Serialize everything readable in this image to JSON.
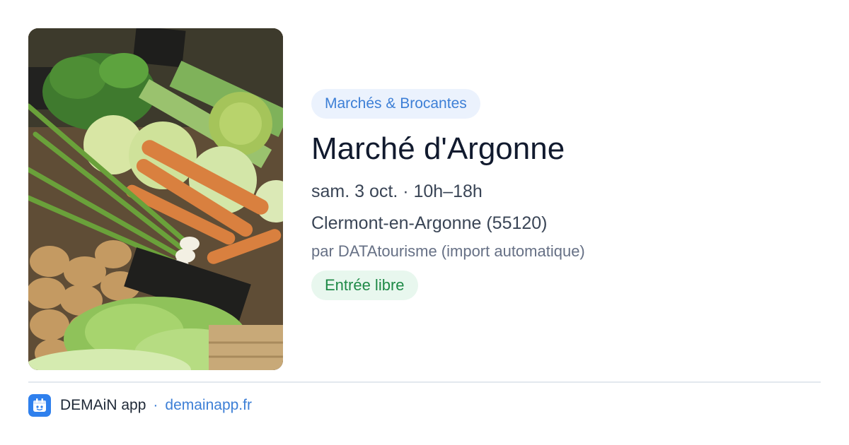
{
  "event": {
    "category": "Marchés & Brocantes",
    "title": "Marché d'Argonne",
    "datetime": "sam. 3 oct. · 10h–18h",
    "location": "Clermont-en-Argonne (55120)",
    "source": "par DATAtourisme (import automatique)",
    "admission": "Entrée libre",
    "image_alt": "Étal de légumes au marché"
  },
  "footer": {
    "app_name": "DEMAiN app",
    "separator": "·",
    "site": "demainapp.fr"
  },
  "colors": {
    "accent": "#3d7fd6",
    "category_bg": "#ebf2fd",
    "admission_text": "#1f8a47",
    "admission_bg": "#e8f7ee",
    "app_icon": "#2f80ed"
  },
  "icons": {
    "app": "calendar-icon"
  }
}
